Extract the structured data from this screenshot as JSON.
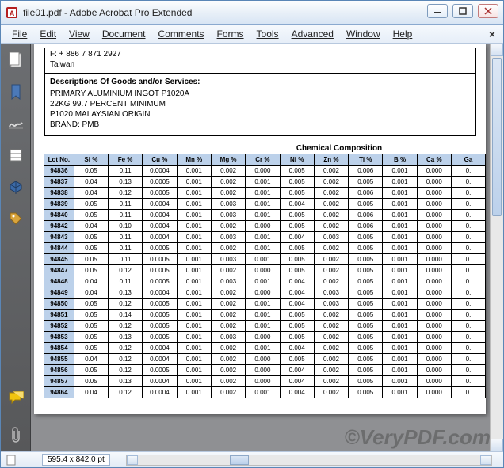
{
  "window": {
    "title": "file01.pdf - Adobe Acrobat Pro Extended"
  },
  "menu": {
    "file": "File",
    "edit": "Edit",
    "view": "View",
    "document": "Document",
    "comments": "Comments",
    "forms": "Forms",
    "tools": "Tools",
    "advanced": "Advanced",
    "window": "Window",
    "help": "Help"
  },
  "nav": {
    "pages": "pages-icon",
    "bookmarks": "bookmark-icon",
    "signatures": "signature-icon",
    "layers": "layers-icon",
    "model": "model-icon",
    "tags": "tag-icon",
    "comments_icon": "comments-icon",
    "attachments": "attachment-icon"
  },
  "doc": {
    "fax_line": "F: + 886 7 871 2927",
    "country": "Taiwan",
    "desc_header": "Descriptions Of Goods and/or Services:",
    "desc1": "PRIMARY ALUMINIUM INGOT P1020A",
    "desc2": "22KG 99.7 PERCENT MINIMUM",
    "desc3": "P1020 MALAYSIAN ORIGIN",
    "desc4": "BRAND: PMB",
    "table_title": "Chemical Composition",
    "headers": [
      "Lot No.",
      "Si %",
      "Fe %",
      "Cu %",
      "Mn %",
      "Mg %",
      "Cr %",
      "Ni %",
      "Zn %",
      "Ti %",
      "B %",
      "Ca %",
      "Ga"
    ],
    "rows": [
      {
        "lot": "94836",
        "v": [
          "0.05",
          "0.11",
          "0.0004",
          "0.001",
          "0.002",
          "0.000",
          "0.005",
          "0.002",
          "0.006",
          "0.001",
          "0.000",
          "0."
        ]
      },
      {
        "lot": "94837",
        "v": [
          "0.04",
          "0.13",
          "0.0005",
          "0.001",
          "0.002",
          "0.001",
          "0.005",
          "0.002",
          "0.005",
          "0.001",
          "0.000",
          "0."
        ]
      },
      {
        "lot": "94838",
        "v": [
          "0.04",
          "0.12",
          "0.0005",
          "0.001",
          "0.002",
          "0.001",
          "0.005",
          "0.002",
          "0.006",
          "0.001",
          "0.000",
          "0."
        ]
      },
      {
        "lot": "94839",
        "v": [
          "0.05",
          "0.11",
          "0.0004",
          "0.001",
          "0.003",
          "0.001",
          "0.004",
          "0.002",
          "0.005",
          "0.001",
          "0.000",
          "0."
        ]
      },
      {
        "lot": "94840",
        "v": [
          "0.05",
          "0.11",
          "0.0004",
          "0.001",
          "0.003",
          "0.001",
          "0.005",
          "0.002",
          "0.006",
          "0.001",
          "0.000",
          "0."
        ]
      },
      {
        "lot": "94842",
        "v": [
          "0.04",
          "0.10",
          "0.0004",
          "0.001",
          "0.002",
          "0.000",
          "0.005",
          "0.002",
          "0.006",
          "0.001",
          "0.000",
          "0."
        ]
      },
      {
        "lot": "94843",
        "v": [
          "0.05",
          "0.11",
          "0.0004",
          "0.001",
          "0.003",
          "0.001",
          "0.004",
          "0.003",
          "0.005",
          "0.001",
          "0.000",
          "0."
        ]
      },
      {
        "lot": "94844",
        "v": [
          "0.05",
          "0.11",
          "0.0005",
          "0.001",
          "0.002",
          "0.001",
          "0.005",
          "0.002",
          "0.005",
          "0.001",
          "0.000",
          "0."
        ]
      },
      {
        "lot": "94845",
        "v": [
          "0.05",
          "0.11",
          "0.0005",
          "0.001",
          "0.003",
          "0.001",
          "0.005",
          "0.002",
          "0.005",
          "0.001",
          "0.000",
          "0."
        ]
      },
      {
        "lot": "94847",
        "v": [
          "0.05",
          "0.12",
          "0.0005",
          "0.001",
          "0.002",
          "0.000",
          "0.005",
          "0.002",
          "0.005",
          "0.001",
          "0.000",
          "0."
        ]
      },
      {
        "lot": "94848",
        "v": [
          "0.04",
          "0.11",
          "0.0005",
          "0.001",
          "0.003",
          "0.001",
          "0.004",
          "0.002",
          "0.005",
          "0.001",
          "0.000",
          "0."
        ]
      },
      {
        "lot": "94849",
        "v": [
          "0.04",
          "0.13",
          "0.0004",
          "0.001",
          "0.002",
          "0.000",
          "0.004",
          "0.003",
          "0.005",
          "0.001",
          "0.000",
          "0."
        ]
      },
      {
        "lot": "94850",
        "v": [
          "0.05",
          "0.12",
          "0.0005",
          "0.001",
          "0.002",
          "0.001",
          "0.004",
          "0.003",
          "0.005",
          "0.001",
          "0.000",
          "0."
        ]
      },
      {
        "lot": "94851",
        "v": [
          "0.05",
          "0.14",
          "0.0005",
          "0.001",
          "0.002",
          "0.001",
          "0.005",
          "0.002",
          "0.005",
          "0.001",
          "0.000",
          "0."
        ]
      },
      {
        "lot": "94852",
        "v": [
          "0.05",
          "0.12",
          "0.0005",
          "0.001",
          "0.002",
          "0.001",
          "0.005",
          "0.002",
          "0.005",
          "0.001",
          "0.000",
          "0."
        ]
      },
      {
        "lot": "94853",
        "v": [
          "0.05",
          "0.13",
          "0.0005",
          "0.001",
          "0.003",
          "0.000",
          "0.005",
          "0.002",
          "0.005",
          "0.001",
          "0.000",
          "0."
        ]
      },
      {
        "lot": "94854",
        "v": [
          "0.05",
          "0.12",
          "0.0004",
          "0.001",
          "0.002",
          "0.001",
          "0.004",
          "0.002",
          "0.005",
          "0.001",
          "0.000",
          "0."
        ]
      },
      {
        "lot": "94855",
        "v": [
          "0.04",
          "0.12",
          "0.0004",
          "0.001",
          "0.002",
          "0.000",
          "0.005",
          "0.002",
          "0.005",
          "0.001",
          "0.000",
          "0."
        ]
      },
      {
        "lot": "94856",
        "v": [
          "0.05",
          "0.12",
          "0.0005",
          "0.001",
          "0.002",
          "0.000",
          "0.004",
          "0.002",
          "0.005",
          "0.001",
          "0.000",
          "0."
        ]
      },
      {
        "lot": "94857",
        "v": [
          "0.05",
          "0.13",
          "0.0004",
          "0.001",
          "0.002",
          "0.000",
          "0.004",
          "0.002",
          "0.005",
          "0.001",
          "0.000",
          "0."
        ]
      },
      {
        "lot": "94864",
        "v": [
          "0.04",
          "0.12",
          "0.0004",
          "0.001",
          "0.002",
          "0.001",
          "0.004",
          "0.002",
          "0.005",
          "0.001",
          "0.000",
          "0."
        ]
      }
    ]
  },
  "status": {
    "page_size": "595.4 x 842.0 pt"
  },
  "watermark": "©VeryPDF.com"
}
